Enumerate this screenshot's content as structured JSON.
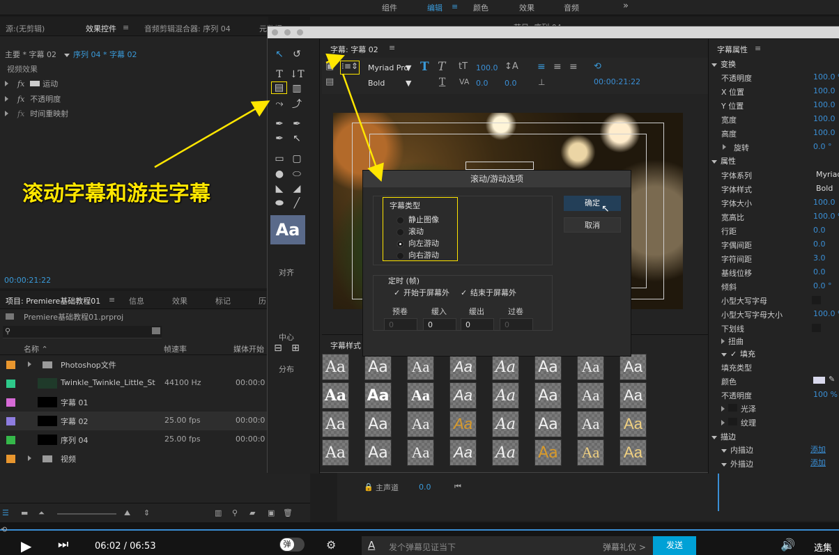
{
  "topbar": {
    "items": [
      "组件",
      "编辑",
      "颜色",
      "效果",
      "音频"
    ],
    "active": 1,
    "more": "»"
  },
  "source_panel": {
    "tabs": [
      "源:(无剪辑)",
      "效果控件",
      "音频剪辑混合器: 序列 04",
      "元数据"
    ],
    "active": 1,
    "master": "主要 * 字幕 02",
    "sequence": "序列 04 * 字幕 02",
    "section": "视频效果",
    "effects": [
      "运动",
      "不透明度",
      "时间重映射"
    ],
    "timecode": "00:00:21:22"
  },
  "project_panel": {
    "tabs": [
      "项目: Premiere基础教程01",
      "信息",
      "效果",
      "标记",
      "历"
    ],
    "file": "Premiere基础教程01.prproj",
    "columns": [
      "名称",
      "帧速率",
      "媒体开始"
    ],
    "items": [
      {
        "name": "Photoshop文件",
        "rate": "",
        "start": "",
        "color": "#e8962e",
        "type": "folder"
      },
      {
        "name": "Twinkle_Twinkle_Little_St",
        "rate": "44100 Hz",
        "start": "00:00:0",
        "color": "#2ec98a",
        "type": "audio"
      },
      {
        "name": "字幕 01",
        "rate": "",
        "start": "",
        "color": "#d66ad6",
        "type": "title"
      },
      {
        "name": "字幕 02",
        "rate": "25.00 fps",
        "start": "00:00:0",
        "color": "#8e7de0",
        "type": "title"
      },
      {
        "name": "序列 04",
        "rate": "25.00 fps",
        "start": "00:00:0",
        "color": "#35b84a",
        "type": "seq"
      },
      {
        "name": "视频",
        "rate": "",
        "start": "",
        "color": "#e8962e",
        "type": "folder"
      }
    ]
  },
  "title_window": {
    "title": "字幕: 字幕 02",
    "font": "Myriad Pro",
    "style": "Bold",
    "size": "100.0",
    "kern": "0.0",
    "lead": "0.0",
    "time": "00:00:21:22",
    "align_section": "对齐",
    "center_section": "中心",
    "dist_section": "分布",
    "styles_title": "字幕样式",
    "sample": "Aa"
  },
  "roll_dialog": {
    "title": "滚动/游动选项",
    "type_label": "字幕类型",
    "options": [
      "静止图像",
      "滚动",
      "向左游动",
      "向右游动"
    ],
    "selected": 2,
    "ok": "确定",
    "cancel": "取消",
    "timing": "定时 (帧)",
    "start_off": "开始于屏幕外",
    "end_off": "结束于屏幕外",
    "fields": [
      {
        "label": "预卷",
        "value": "0"
      },
      {
        "label": "缓入",
        "value": "0"
      },
      {
        "label": "缓出",
        "value": "0"
      },
      {
        "label": "过卷",
        "value": "0"
      }
    ]
  },
  "annotation": "滚动字幕和游走字幕",
  "props": {
    "header": "字幕属性",
    "transform": "变换",
    "transform_rows": [
      [
        "不透明度",
        "100.0 %"
      ],
      [
        "X 位置",
        "100.0"
      ],
      [
        "Y 位置",
        "100.0"
      ],
      [
        "宽度",
        "100.0"
      ],
      [
        "高度",
        "100.0"
      ],
      [
        "旋转",
        "0.0 °"
      ]
    ],
    "attrs": "属性",
    "attr_rows": [
      [
        "字体系列",
        "Myriad"
      ],
      [
        "字体样式",
        "Bold"
      ],
      [
        "字体大小",
        "100.0"
      ],
      [
        "宽高比",
        "100.0 %"
      ],
      [
        "行距",
        "0.0"
      ],
      [
        "字偶间距",
        "0.0"
      ],
      [
        "字符间距",
        "3.0"
      ],
      [
        "基线位移",
        "0.0"
      ],
      [
        "倾斜",
        "0.0 °"
      ],
      [
        "小型大写字母",
        ""
      ],
      [
        "小型大写字母大小",
        "100.0 %"
      ],
      [
        "下划线",
        ""
      ]
    ],
    "distort": "扭曲",
    "fill": "填充",
    "fill_type": "填充类型",
    "color": "颜色",
    "opacity": "不透明度",
    "opacity_val": "100 %",
    "sheen": "光泽",
    "texture": "纹理",
    "stroke": "描边",
    "inner": "内描边",
    "outer": "外描边",
    "add": "添加"
  },
  "program": {
    "tab": "节目: 序列 04",
    "channel": "主声道",
    "channel_val": "0.0"
  },
  "player": {
    "time": "06:02",
    "duration": "06:53",
    "danmaku_btn": "弹",
    "placeholder": "发个弹幕见证当下",
    "gift": "弹幕礼仪 >",
    "send": "发送",
    "episodes": "选集"
  }
}
